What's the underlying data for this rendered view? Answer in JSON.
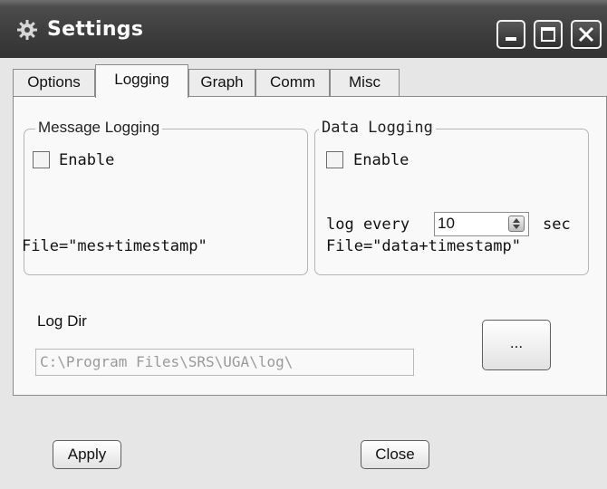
{
  "window": {
    "title": "Settings"
  },
  "tabs": [
    {
      "label": "Options"
    },
    {
      "label": "Logging"
    },
    {
      "label": "Graph"
    },
    {
      "label": "Comm"
    },
    {
      "label": "Misc"
    }
  ],
  "message_logging": {
    "title": "Message Logging",
    "enable_label": "Enable",
    "enabled": false,
    "file_text": "File=\"mes+timestamp\""
  },
  "data_logging": {
    "title": "Data Logging",
    "enable_label": "Enable",
    "enabled": false,
    "log_every_label": "log every",
    "log_every_value": "10",
    "unit": "sec",
    "file_text": "File=\"data+timestamp\""
  },
  "log_dir": {
    "label": "Log Dir",
    "path": "C:\\Program Files\\SRS\\UGA\\log\\",
    "browse_label": "..."
  },
  "footer": {
    "apply_label": "Apply",
    "close_label": "Close"
  },
  "icons": {
    "app": "gear-icon",
    "minimize": "minimize-icon",
    "maximize": "maximize-icon",
    "close": "close-icon",
    "spinner": "spin-arrows-icon"
  }
}
